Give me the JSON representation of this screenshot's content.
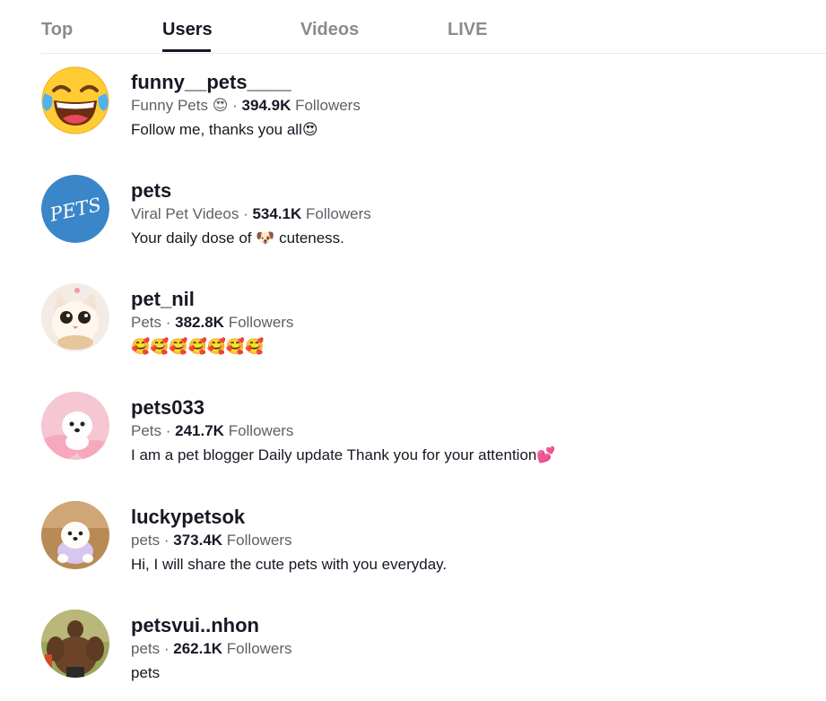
{
  "tabs": [
    {
      "label": "Top"
    },
    {
      "label": "Users"
    },
    {
      "label": "Videos"
    },
    {
      "label": "LIVE"
    }
  ],
  "active_tab": "Users",
  "users": [
    {
      "username": "funny__pets____",
      "display_name": "Funny Pets 😍",
      "separator": " · ",
      "followers_count": "394.9K",
      "followers_label": " Followers",
      "bio": "Follow me, thanks you all😍",
      "avatar_icon": "laughing-emoji-icon"
    },
    {
      "username": "pets",
      "display_name": "Viral Pet Videos",
      "separator": " · ",
      "followers_count": "534.1K",
      "followers_label": " Followers",
      "bio": "Your daily dose of 🐶 cuteness.",
      "avatar_icon": "pets-logo-icon",
      "avatar_text": "PETS"
    },
    {
      "username": "pet_nil",
      "display_name": "Pets",
      "separator": " · ",
      "followers_count": "382.8K",
      "followers_label": " Followers",
      "bio": "🥰🥰🥰🥰🥰🥰🥰",
      "avatar_icon": "cat-photo-icon"
    },
    {
      "username": "pets033",
      "display_name": "Pets",
      "separator": " · ",
      "followers_count": "241.7K",
      "followers_label": " Followers",
      "bio": "I am a pet blogger Daily update Thank you for your attention💕",
      "avatar_icon": "puppy-photo-icon"
    },
    {
      "username": "luckypetsok",
      "display_name": "pets",
      "separator": " · ",
      "followers_count": "373.4K",
      "followers_label": " Followers",
      "bio": "Hi, I will share the cute pets with you everyday.",
      "avatar_icon": "puppy-photo-icon"
    },
    {
      "username": "petsvui..nhon",
      "display_name": "pets",
      "separator": " · ",
      "followers_count": "262.1K",
      "followers_label": " Followers",
      "bio": "pets",
      "avatar_icon": "bodybuilder-photo-icon"
    }
  ],
  "colors": {
    "primary_text": "#161823",
    "secondary_text": "#5f6068",
    "inactive_tab": "#8a8b91",
    "divider": "#e8e8ea",
    "pets_logo_blue": "#3a86c8"
  }
}
